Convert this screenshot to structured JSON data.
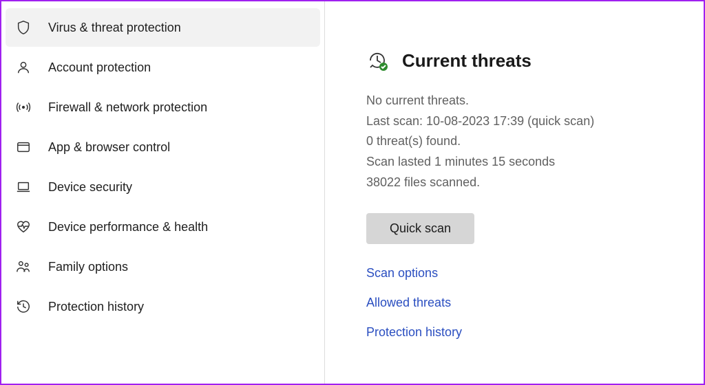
{
  "sidebar": {
    "items": [
      {
        "id": "virus-threat",
        "label": "Virus & threat protection",
        "icon": "shield",
        "active": true
      },
      {
        "id": "account",
        "label": "Account protection",
        "icon": "person",
        "active": false
      },
      {
        "id": "firewall",
        "label": "Firewall & network protection",
        "icon": "antenna",
        "active": false
      },
      {
        "id": "app-browser",
        "label": "App & browser control",
        "icon": "window",
        "active": false
      },
      {
        "id": "device-security",
        "label": "Device security",
        "icon": "laptop",
        "active": false
      },
      {
        "id": "performance",
        "label": "Device performance & health",
        "icon": "heart",
        "active": false
      },
      {
        "id": "family",
        "label": "Family options",
        "icon": "family",
        "active": false
      },
      {
        "id": "history",
        "label": "Protection history",
        "icon": "history",
        "active": false
      }
    ]
  },
  "main": {
    "section_title": "Current threats",
    "status": {
      "line1": "No current threats.",
      "line2": "Last scan: 10-08-2023 17:39 (quick scan)",
      "line3": "0 threat(s) found.",
      "line4": "Scan lasted 1 minutes 15 seconds",
      "line5": "38022 files scanned."
    },
    "quick_scan_label": "Quick scan",
    "links": {
      "scan_options": "Scan options",
      "allowed_threats": "Allowed threats",
      "protection_history": "Protection history"
    }
  },
  "annotation": {
    "arrow_color": "#8a2be2",
    "target": "scan_options"
  }
}
